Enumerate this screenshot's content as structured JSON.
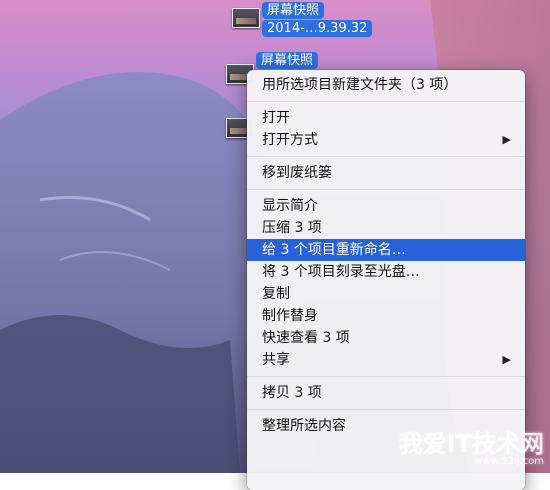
{
  "desktop": {
    "files": [
      {
        "label": "屏幕快照",
        "label2": "2014-…9.39.32"
      },
      {
        "label": "屏幕快照"
      }
    ]
  },
  "context_menu": {
    "items": [
      {
        "label": "用所选项目新建文件夹（3 项）"
      },
      {
        "label": "打开"
      },
      {
        "label": "打开方式",
        "arrow": "▶"
      },
      {
        "label": "移到废纸篓"
      },
      {
        "label": "显示简介"
      },
      {
        "label": "压缩 3 项"
      },
      {
        "label": "给 3 个项目重新命名…"
      },
      {
        "label": "将 3 个项目刻录至光盘…"
      },
      {
        "label": "复制"
      },
      {
        "label": "制作替身"
      },
      {
        "label": "快速查看 3 项"
      },
      {
        "label": "共享",
        "arrow": "▶"
      },
      {
        "label": "拷贝 3 项"
      },
      {
        "label": "整理所选内容"
      }
    ]
  },
  "watermark": {
    "text": "我爱IT技术网",
    "sub": "www.52ij.com"
  }
}
